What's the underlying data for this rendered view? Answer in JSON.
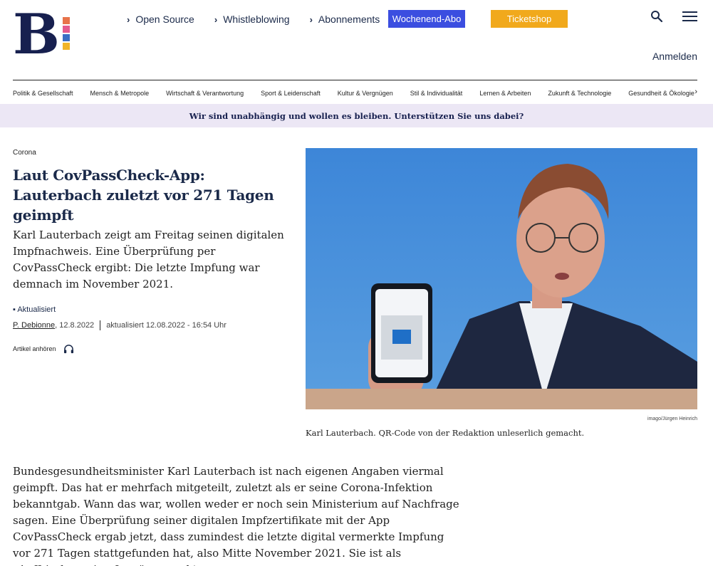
{
  "header": {
    "nav": [
      "Open Source",
      "Whistleblowing",
      "Abonnements"
    ],
    "btn_wochenend": "Wochenend-Abo",
    "btn_ticketshop": "Ticketshop",
    "login": "Anmelden",
    "logo_letter": "B",
    "colors": {
      "navy": "#17204f",
      "wochenend": "#3b4ee0",
      "ticketshop": "#f1a91c"
    }
  },
  "categories": [
    "Politik & Gesellschaft",
    "Mensch & Metropole",
    "Wirtschaft & Verantwortung",
    "Sport & Leidenschaft",
    "Kultur & Vergnügen",
    "Stil & Individualität",
    "Lernen & Arbeiten",
    "Zukunft & Technologie",
    "Gesundheit & Ökologie"
  ],
  "banner": "Wir sind unabhängig und wollen es bleiben. Unterstützen Sie uns dabei?",
  "article": {
    "kicker": "Corona",
    "headline": "Laut CovPassCheck-App: Lauterbach zuletzt vor 271 Tagen geimpft",
    "lead": "Karl Lauterbach zeigt am Freitag seinen digitalen Impfnachweis. Eine Überprüfung per CovPassCheck ergibt: Die letzte Impfung war demnach im November 2021.",
    "updated_label": "▪ Aktualisiert",
    "author": "P. Debionne",
    "date": ", 12.8.2022",
    "updated_text": "aktualisiert 12.08.2022 - 16:54 Uhr",
    "listen": "Artikel anhören",
    "photo_credit": "imago/Jürgen Heinrich",
    "caption": "Karl Lauterbach. QR-Code von der Redaktion unleserlich gemacht.",
    "body": "Bundesgesundheitsminister Karl Lauterbach ist nach eigenen Angaben viermal geimpft. Das hat er mehrfach mitgeteilt, zuletzt als er seine Corona-Infektion bekanntgab. Wann das war, wollen weder er noch sein Ministerium auf Nachfrage sagen. Eine Überprüfung seiner digitalen Impfzertifikate mit der App CovPassCheck ergab jetzt, dass zumindest die letzte digital vermerkte Impfung vor 271 Tagen stattgefunden hat, also Mitte November 2021. Sie ist als „Auffrischungsimpfung“ vermerkt."
  }
}
